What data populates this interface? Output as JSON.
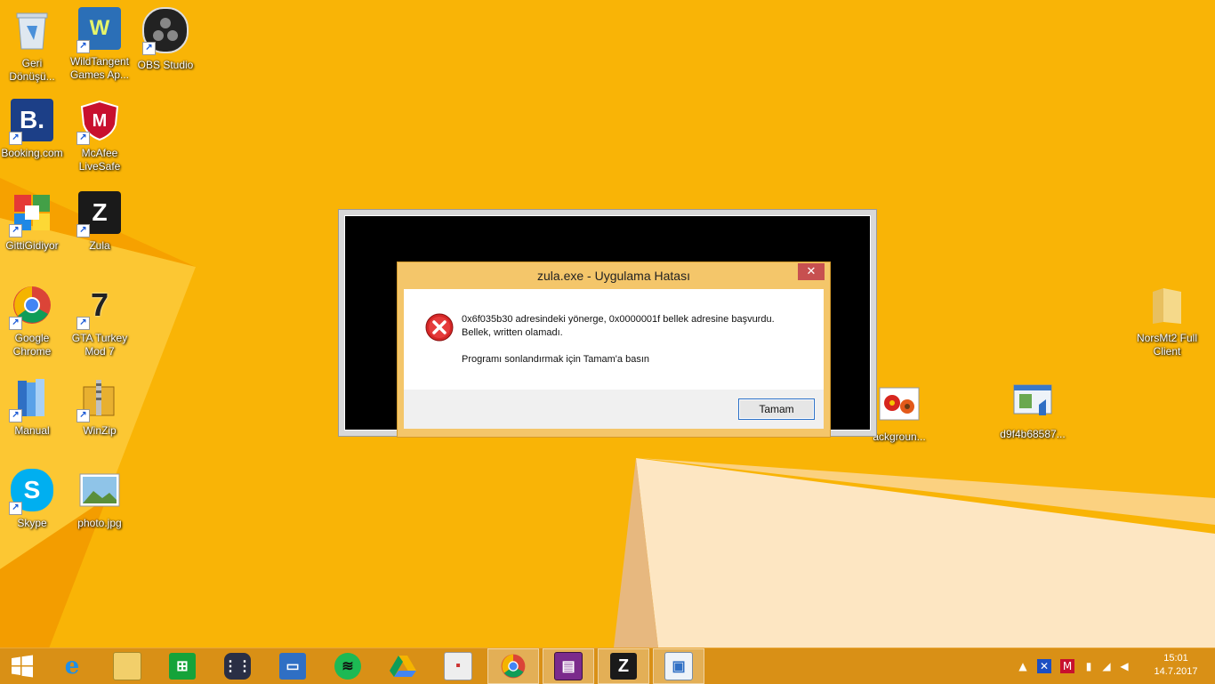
{
  "desktop": {
    "icons": [
      {
        "label": "Geri Dönüşü..."
      },
      {
        "label": "WildTangent Games Ap..."
      },
      {
        "label": "OBS Studio"
      },
      {
        "label": "Booking.com"
      },
      {
        "label": "McAfee LiveSafe"
      },
      {
        "label": "GittiGidiyor"
      },
      {
        "label": "Zula"
      },
      {
        "label": "Google Chrome"
      },
      {
        "label": "GTA Turkey Mod 7"
      },
      {
        "label": "Manual"
      },
      {
        "label": "WinZip"
      },
      {
        "label": "Skype"
      },
      {
        "label": "photo.jpg"
      },
      {
        "label": "NorsMt2 Full Client"
      },
      {
        "label": "ackgroun..."
      },
      {
        "label": "d9f4b68587..."
      }
    ]
  },
  "dialog": {
    "title": "zula.exe - Uygulama Hatası",
    "close_label": "✕",
    "message_line1": "0x6f035b30 adresindeki yönerge, 0x0000001f bellek adresine başvurdu.",
    "message_line2": "Bellek, written olamadı.",
    "message_line3": "Programı sonlandırmak için Tamam'a basın",
    "ok_label": "Tamam"
  },
  "taskbar": {
    "items": [
      {
        "icon": "windows-start-icon"
      },
      {
        "icon": "internet-explorer-icon"
      },
      {
        "icon": "file-explorer-icon"
      },
      {
        "icon": "windows-store-icon"
      },
      {
        "icon": "apps-grid-icon"
      },
      {
        "icon": "chat-icon"
      },
      {
        "icon": "spotify-icon"
      },
      {
        "icon": "google-drive-icon"
      },
      {
        "icon": "remote-icon"
      },
      {
        "icon": "chrome-icon"
      },
      {
        "icon": "winrar-icon"
      },
      {
        "icon": "zula-icon"
      },
      {
        "icon": "error-window-icon"
      }
    ],
    "clock_time": "15:01",
    "clock_date": "14.7.2017"
  }
}
